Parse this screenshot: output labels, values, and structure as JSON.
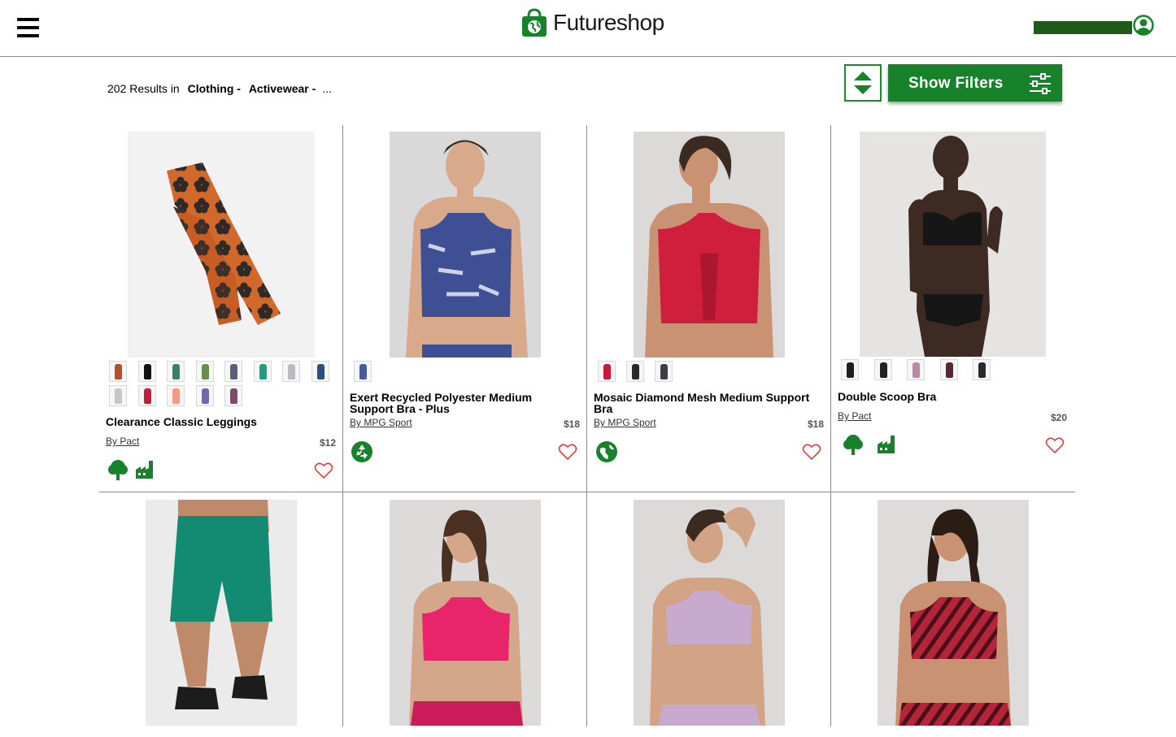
{
  "header": {
    "logo_text": "Futureshop",
    "menu_icon": "hamburger-icon",
    "account_icon": "user-icon"
  },
  "toolbar": {
    "results_count": "202 Results in",
    "crumb1": "Clothing -",
    "crumb2": "Activewear -",
    "crumb_more": "...",
    "filter_label": "Show Filters",
    "sort_icon": "sort-icon",
    "filter_icon": "sliders-icon"
  },
  "colors": {
    "brand_green": "#17822a",
    "heart": "#e0413c"
  },
  "products": [
    {
      "title": "Clearance Classic Leggings",
      "brand": "By Pact",
      "price": "$12",
      "badges": [
        "tree-icon",
        "factory-icon"
      ],
      "swatches": [
        "#b0512b",
        "#111111",
        "#3e7d6a",
        "#6b8f4a",
        "#5a5f7a",
        "#1e9e84",
        "#b9bcc0",
        "#2f4f78",
        "#c8c6c3",
        "#c41e3a",
        "#f29a86",
        "#6f6aa8",
        "#7b4a6e"
      ]
    },
    {
      "title": "Exert Recycled Polyester Medium Support Bra - Plus",
      "brand": "By MPG Sport",
      "price": "$18",
      "badges": [
        "recycle-icon"
      ],
      "swatches": [
        "#4a5a9a"
      ]
    },
    {
      "title": "Mosaic Diamond Mesh Medium Support Bra",
      "brand": "By MPG Sport",
      "price": "$18",
      "badges": [
        "globe-icon"
      ],
      "swatches": [
        "#c8193a",
        "#2a2a2a",
        "#3a3f46"
      ]
    },
    {
      "title": "Double Scoop Bra",
      "brand": "By Pact",
      "price": "$20",
      "badges": [
        "tree-icon",
        "factory-icon"
      ],
      "swatches": [
        "#1e1e1e",
        "#222222",
        "#b58aa2",
        "#5a2630",
        "#2b2b2b"
      ]
    },
    {
      "title": "",
      "brand": "",
      "price": "",
      "badges": [],
      "swatches": []
    },
    {
      "title": "",
      "brand": "",
      "price": "",
      "badges": [],
      "swatches": []
    },
    {
      "title": "",
      "brand": "",
      "price": "",
      "badges": [],
      "swatches": []
    },
    {
      "title": "",
      "brand": "",
      "price": "",
      "badges": [],
      "swatches": []
    }
  ]
}
